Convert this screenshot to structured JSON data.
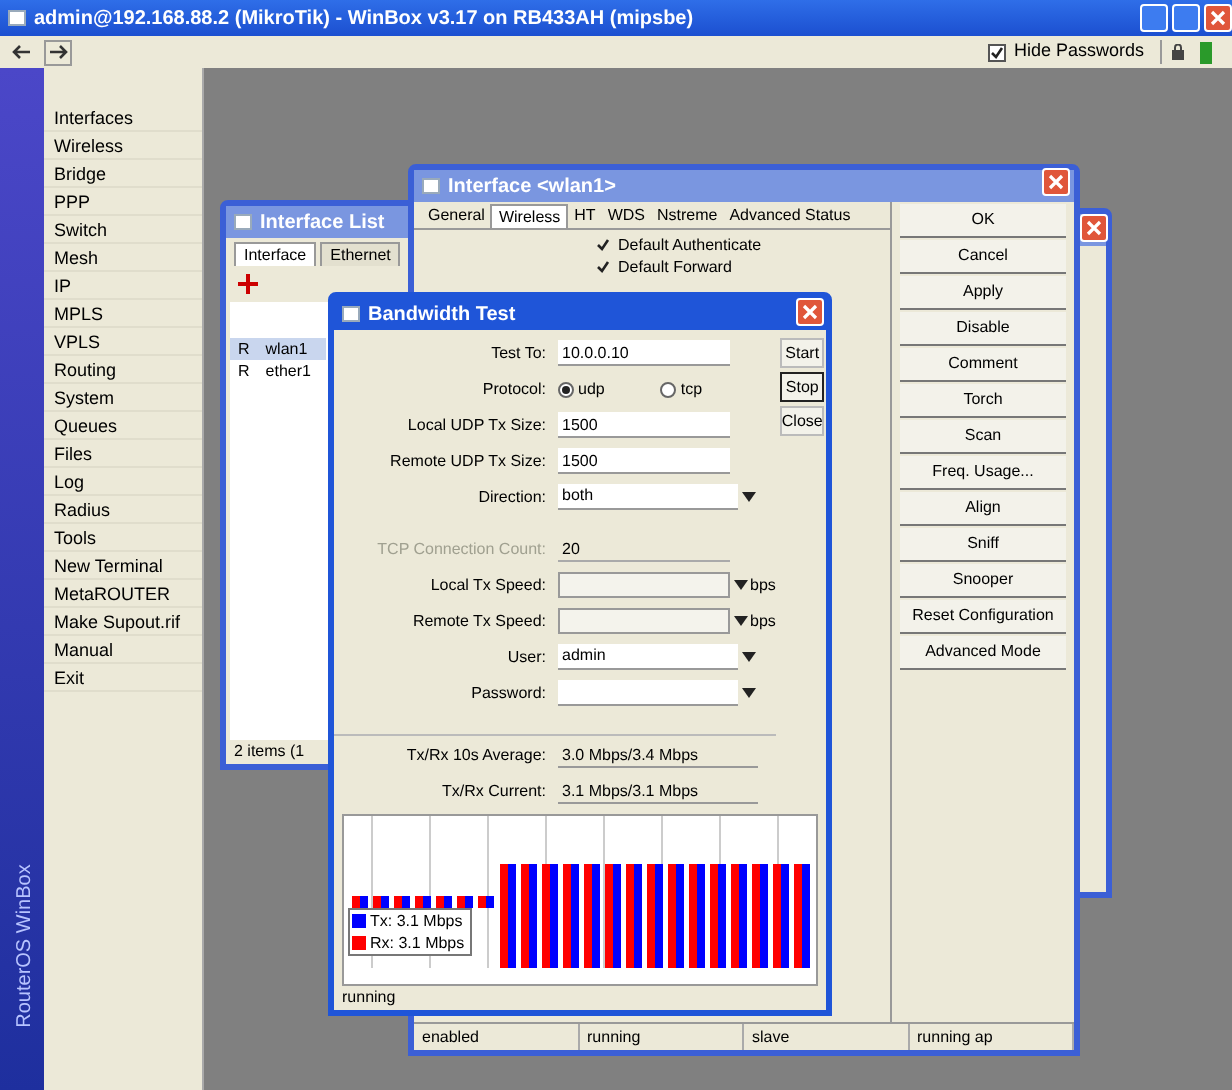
{
  "window": {
    "title": "admin@192.168.88.2 (MikroTik) - WinBox v3.17 on RB433AH (mipsbe)"
  },
  "toolbar": {
    "hide_passwords": {
      "label": "Hide Passwords",
      "checked": true
    }
  },
  "sidebar": {
    "brand": "RouterOS WinBox",
    "items": [
      {
        "label": "Interfaces"
      },
      {
        "label": "Wireless"
      },
      {
        "label": "Bridge"
      },
      {
        "label": "PPP"
      },
      {
        "label": "Switch"
      },
      {
        "label": "Mesh"
      },
      {
        "label": "IP"
      },
      {
        "label": "MPLS"
      },
      {
        "label": "VPLS"
      },
      {
        "label": "Routing"
      },
      {
        "label": "System"
      },
      {
        "label": "Queues"
      },
      {
        "label": "Files"
      },
      {
        "label": "Log"
      },
      {
        "label": "Radius"
      },
      {
        "label": "Tools"
      },
      {
        "label": "New Terminal"
      },
      {
        "label": "MetaROUTER"
      },
      {
        "label": "Make Supout.rif"
      },
      {
        "label": "Manual"
      },
      {
        "label": "Exit"
      }
    ]
  },
  "interface_list": {
    "title": "Interface List",
    "tabs": [
      {
        "label": "Interface",
        "selected": true
      },
      {
        "label": "Ethernet",
        "selected": false
      }
    ],
    "rows": [
      {
        "flag": "R",
        "name": "wlan1",
        "selected": true
      },
      {
        "flag": "R",
        "name": "ether1",
        "selected": false
      }
    ],
    "status": "2 items (1"
  },
  "wireless_window": {
    "title": "Interface <wlan1>",
    "tabs": [
      {
        "label": "General",
        "selected": false
      },
      {
        "label": "Wireless",
        "selected": true
      },
      {
        "label": "HT",
        "selected": false
      },
      {
        "label": "WDS",
        "selected": false
      },
      {
        "label": "Nstreme",
        "selected": false
      },
      {
        "label": "Advanced Status",
        "selected": false
      }
    ],
    "checks": [
      {
        "label": "Default Authenticate",
        "checked": true
      },
      {
        "label": "Default Forward",
        "checked": true
      }
    ],
    "buttons": [
      "OK",
      "Cancel",
      "Apply",
      "Disable",
      "Comment",
      "Torch",
      "Scan",
      "Freq. Usage...",
      "Align",
      "Sniff",
      "Snooper",
      "Reset Configuration",
      "Advanced Mode"
    ],
    "status": [
      "enabled",
      "running",
      "slave",
      "running ap"
    ]
  },
  "bandwidth_test": {
    "title": "Bandwidth Test",
    "fields": [
      {
        "kind": "text",
        "label": "Test To:",
        "value": "10.0.0.10"
      },
      {
        "kind": "radio",
        "label": "Protocol:",
        "options": [
          {
            "label": "udp",
            "selected": true
          },
          {
            "label": "tcp",
            "selected": false
          }
        ]
      },
      {
        "kind": "text",
        "label": "Local UDP Tx Size:",
        "value": "1500"
      },
      {
        "kind": "text",
        "label": "Remote UDP Tx Size:",
        "value": "1500"
      },
      {
        "kind": "dropdown",
        "label": "Direction:",
        "value": "both"
      },
      {
        "kind": "text",
        "label": "TCP Connection Count:",
        "value": "20",
        "disabled": true
      },
      {
        "kind": "speed",
        "label": "Local Tx Speed:",
        "unit": "bps"
      },
      {
        "kind": "speed",
        "label": "Remote Tx Speed:",
        "unit": "bps"
      },
      {
        "kind": "dropdown",
        "label": "User:",
        "value": "admin"
      },
      {
        "kind": "dropdown",
        "label": "Password:"
      },
      {
        "kind": "readout",
        "label": "Tx/Rx 10s Average:",
        "value": "3.0 Mbps/3.4 Mbps"
      },
      {
        "kind": "readout",
        "label": "Tx/Rx Current:",
        "value": "3.1 Mbps/3.1 Mbps"
      }
    ],
    "buttons": [
      {
        "label": "Start",
        "focused": false
      },
      {
        "label": "Stop",
        "focused": true
      },
      {
        "label": "Close",
        "focused": false
      }
    ],
    "legend": [
      {
        "label": "Tx: 3.1 Mbps",
        "color": "#0000ff"
      },
      {
        "label": "Rx: 3.1 Mbps",
        "color": "#ff0000"
      }
    ],
    "status": "running"
  }
}
